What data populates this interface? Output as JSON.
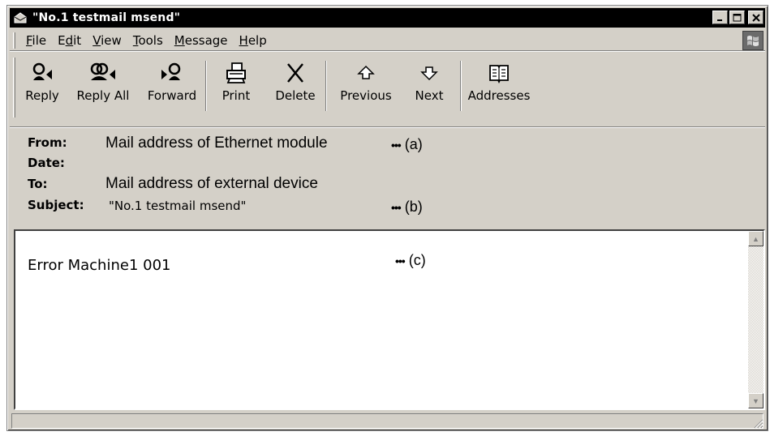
{
  "window": {
    "title": "\"No.1 testmail msend\"",
    "controls": {
      "minimize": "_",
      "maximize": "□",
      "close": "×"
    }
  },
  "menu": [
    {
      "pre": "",
      "ul": "F",
      "post": "ile"
    },
    {
      "pre": "E",
      "ul": "d",
      "post": "it"
    },
    {
      "pre": "",
      "ul": "V",
      "post": "iew"
    },
    {
      "pre": "",
      "ul": "T",
      "post": "ools"
    },
    {
      "pre": "",
      "ul": "M",
      "post": "essage"
    },
    {
      "pre": "",
      "ul": "H",
      "post": "elp"
    }
  ],
  "toolbar": {
    "reply": "Reply",
    "reply_all": "Reply All",
    "forward": "Forward",
    "print": "Print",
    "delete": "Delete",
    "previous": "Previous",
    "next": "Next",
    "addresses": "Addresses"
  },
  "headers": {
    "from_label": "From:",
    "from_value": "Mail address of Ethernet module",
    "date_label": "Date:",
    "to_label": "To:",
    "to_value": "Mail address of external device",
    "subject_label": "Subject:",
    "subject_value": "\"No.1 testmail msend\"",
    "note_a": "(a)",
    "note_b": "(b)"
  },
  "body": {
    "text": "Error Machine1 001",
    "note_c": "(c)"
  },
  "dots": "•••",
  "icons": {
    "title": "envelope-icon",
    "throbber": "windows-logo-icon",
    "scroll_up": "arrow-up-icon",
    "scroll_down": "arrow-down-icon"
  },
  "colors": {
    "title_bar": "#000000",
    "chrome": "#d4d0c8",
    "body_bg": "#ffffff"
  }
}
